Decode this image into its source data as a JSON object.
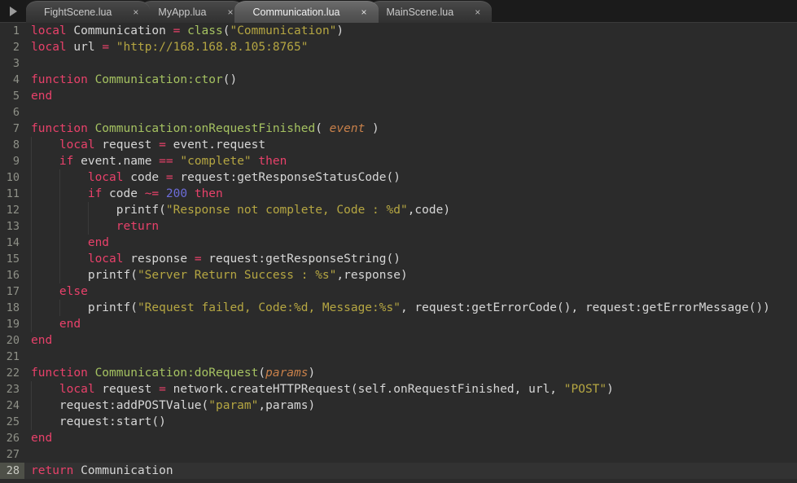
{
  "window": {
    "title": "Communication.lua",
    "theme": "dark",
    "background": "#2b2b2b"
  },
  "toolbar": {
    "run_icon": "play-triangle-icon"
  },
  "tabs": [
    {
      "label": "FightScene.lua",
      "close": "×",
      "active": false
    },
    {
      "label": "MyApp.lua",
      "close": "×",
      "active": false
    },
    {
      "label": "Communication.lua",
      "close": "×",
      "active": true
    },
    {
      "label": "MainScene.lua",
      "close": "×",
      "active": false
    }
  ],
  "colors": {
    "keyword": "#e8416a",
    "function": "#a5c261",
    "string": "#b5a642",
    "number": "#6c6cd8",
    "parameter": "#c8804a",
    "plain": "#d6d6d6",
    "gutter_text": "#8f9188",
    "current_line_gutter": "#4e5048"
  },
  "editor": {
    "language": "lua",
    "current_line": 28,
    "total_lines": 28,
    "lines": [
      {
        "n": "1",
        "indent": 0,
        "tokens": [
          {
            "t": "local",
            "c": "kw"
          },
          {
            "t": " Communication ",
            "c": "pl"
          },
          {
            "t": "=",
            "c": "kw"
          },
          {
            "t": " ",
            "c": "pl"
          },
          {
            "t": "class",
            "c": "fn"
          },
          {
            "t": "(",
            "c": "pl"
          },
          {
            "t": "\"Communication\"",
            "c": "str"
          },
          {
            "t": ")",
            "c": "pl"
          }
        ]
      },
      {
        "n": "2",
        "indent": 0,
        "tokens": [
          {
            "t": "local",
            "c": "kw"
          },
          {
            "t": " url ",
            "c": "pl"
          },
          {
            "t": "=",
            "c": "kw"
          },
          {
            "t": " ",
            "c": "pl"
          },
          {
            "t": "\"http://168.168.8.105:8765\"",
            "c": "str"
          }
        ]
      },
      {
        "n": "3",
        "indent": 0,
        "tokens": []
      },
      {
        "n": "4",
        "indent": 0,
        "tokens": [
          {
            "t": "function",
            "c": "kw"
          },
          {
            "t": " ",
            "c": "pl"
          },
          {
            "t": "Communication:ctor",
            "c": "fn"
          },
          {
            "t": "()",
            "c": "pl"
          }
        ]
      },
      {
        "n": "5",
        "indent": 0,
        "tokens": [
          {
            "t": "end",
            "c": "kw"
          }
        ]
      },
      {
        "n": "6",
        "indent": 0,
        "tokens": []
      },
      {
        "n": "7",
        "indent": 0,
        "tokens": [
          {
            "t": "function",
            "c": "kw"
          },
          {
            "t": " ",
            "c": "pl"
          },
          {
            "t": "Communication:onRequestFinished",
            "c": "fn"
          },
          {
            "t": "( ",
            "c": "pl"
          },
          {
            "t": "event",
            "c": "par"
          },
          {
            "t": " )",
            "c": "pl"
          }
        ]
      },
      {
        "n": "8",
        "indent": 1,
        "tokens": [
          {
            "t": "    ",
            "c": "pl"
          },
          {
            "t": "local",
            "c": "kw"
          },
          {
            "t": " request ",
            "c": "pl"
          },
          {
            "t": "=",
            "c": "kw"
          },
          {
            "t": " event.request",
            "c": "pl"
          }
        ]
      },
      {
        "n": "9",
        "indent": 1,
        "tokens": [
          {
            "t": "    ",
            "c": "pl"
          },
          {
            "t": "if",
            "c": "kw"
          },
          {
            "t": " event.name ",
            "c": "pl"
          },
          {
            "t": "==",
            "c": "kw"
          },
          {
            "t": " ",
            "c": "pl"
          },
          {
            "t": "\"complete\"",
            "c": "str"
          },
          {
            "t": " ",
            "c": "pl"
          },
          {
            "t": "then",
            "c": "kw"
          }
        ]
      },
      {
        "n": "10",
        "indent": 2,
        "tokens": [
          {
            "t": "        ",
            "c": "pl"
          },
          {
            "t": "local",
            "c": "kw"
          },
          {
            "t": " code ",
            "c": "pl"
          },
          {
            "t": "=",
            "c": "kw"
          },
          {
            "t": " request:getResponseStatusCode()",
            "c": "pl"
          }
        ]
      },
      {
        "n": "11",
        "indent": 2,
        "tokens": [
          {
            "t": "        ",
            "c": "pl"
          },
          {
            "t": "if",
            "c": "kw"
          },
          {
            "t": " code ",
            "c": "pl"
          },
          {
            "t": "~=",
            "c": "kw"
          },
          {
            "t": " ",
            "c": "pl"
          },
          {
            "t": "200",
            "c": "num"
          },
          {
            "t": " ",
            "c": "pl"
          },
          {
            "t": "then",
            "c": "kw"
          }
        ]
      },
      {
        "n": "12",
        "indent": 3,
        "tokens": [
          {
            "t": "            printf(",
            "c": "pl"
          },
          {
            "t": "\"Response not complete, Code : %d\"",
            "c": "str"
          },
          {
            "t": ",code)",
            "c": "pl"
          }
        ]
      },
      {
        "n": "13",
        "indent": 3,
        "tokens": [
          {
            "t": "            ",
            "c": "pl"
          },
          {
            "t": "return",
            "c": "kw"
          }
        ]
      },
      {
        "n": "14",
        "indent": 2,
        "tokens": [
          {
            "t": "        ",
            "c": "pl"
          },
          {
            "t": "end",
            "c": "kw"
          }
        ]
      },
      {
        "n": "15",
        "indent": 2,
        "tokens": [
          {
            "t": "        ",
            "c": "pl"
          },
          {
            "t": "local",
            "c": "kw"
          },
          {
            "t": " response ",
            "c": "pl"
          },
          {
            "t": "=",
            "c": "kw"
          },
          {
            "t": " request:getResponseString()",
            "c": "pl"
          }
        ]
      },
      {
        "n": "16",
        "indent": 2,
        "tokens": [
          {
            "t": "        printf(",
            "c": "pl"
          },
          {
            "t": "\"Server Return Success : %s\"",
            "c": "str"
          },
          {
            "t": ",response)",
            "c": "pl"
          }
        ]
      },
      {
        "n": "17",
        "indent": 1,
        "tokens": [
          {
            "t": "    ",
            "c": "pl"
          },
          {
            "t": "else",
            "c": "kw"
          }
        ]
      },
      {
        "n": "18",
        "indent": 2,
        "tokens": [
          {
            "t": "        printf(",
            "c": "pl"
          },
          {
            "t": "\"Request failed, Code:%d, Message:%s\"",
            "c": "str"
          },
          {
            "t": ", request:getErrorCode(), request:getErrorMessage())",
            "c": "pl"
          }
        ]
      },
      {
        "n": "19",
        "indent": 1,
        "tokens": [
          {
            "t": "    ",
            "c": "pl"
          },
          {
            "t": "end",
            "c": "kw"
          }
        ]
      },
      {
        "n": "20",
        "indent": 0,
        "tokens": [
          {
            "t": "end",
            "c": "kw"
          }
        ]
      },
      {
        "n": "21",
        "indent": 0,
        "tokens": []
      },
      {
        "n": "22",
        "indent": 0,
        "tokens": [
          {
            "t": "function",
            "c": "kw"
          },
          {
            "t": " ",
            "c": "pl"
          },
          {
            "t": "Communication:doRequest",
            "c": "fn"
          },
          {
            "t": "(",
            "c": "pl"
          },
          {
            "t": "params",
            "c": "par"
          },
          {
            "t": ")",
            "c": "pl"
          }
        ]
      },
      {
        "n": "23",
        "indent": 1,
        "tokens": [
          {
            "t": "    ",
            "c": "pl"
          },
          {
            "t": "local",
            "c": "kw"
          },
          {
            "t": " request ",
            "c": "pl"
          },
          {
            "t": "=",
            "c": "kw"
          },
          {
            "t": " network.createHTTPRequest(self.onRequestFinished, url, ",
            "c": "pl"
          },
          {
            "t": "\"POST\"",
            "c": "str"
          },
          {
            "t": ")",
            "c": "pl"
          }
        ]
      },
      {
        "n": "24",
        "indent": 1,
        "tokens": [
          {
            "t": "    request:addPOSTValue(",
            "c": "pl"
          },
          {
            "t": "\"param\"",
            "c": "str"
          },
          {
            "t": ",params)",
            "c": "pl"
          }
        ]
      },
      {
        "n": "25",
        "indent": 1,
        "tokens": [
          {
            "t": "    request:start()",
            "c": "pl"
          }
        ]
      },
      {
        "n": "26",
        "indent": 0,
        "tokens": [
          {
            "t": "end",
            "c": "kw"
          }
        ]
      },
      {
        "n": "27",
        "indent": 0,
        "tokens": []
      },
      {
        "n": "28",
        "indent": 0,
        "tokens": [
          {
            "t": "return",
            "c": "kw"
          },
          {
            "t": " Communication",
            "c": "pl"
          }
        ]
      }
    ]
  }
}
